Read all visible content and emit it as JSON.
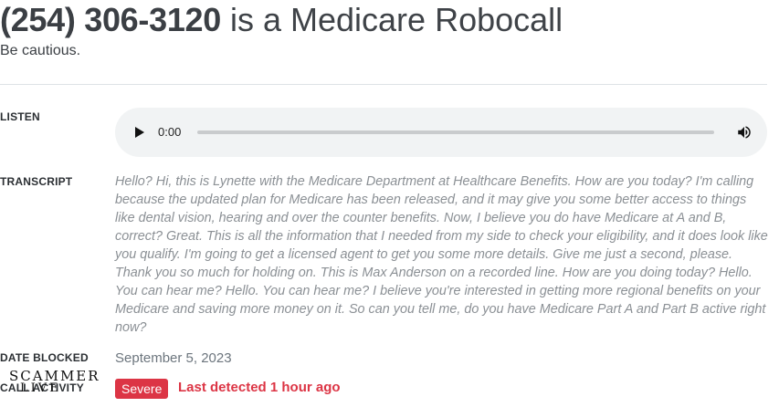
{
  "header": {
    "phone": "(254) 306-3120",
    "title_rest": " is a Medicare Robocall",
    "subtitle": "Be cautious."
  },
  "listen": {
    "label": "LISTEN",
    "player": {
      "time": "0:00",
      "progress": 0
    }
  },
  "transcript": {
    "label": "TRANSCRIPT",
    "text": "Hello? Hi, this is Lynette with the Medicare Department at Healthcare Benefits. How are you today? I'm calling because the updated plan for Medicare has been released, and it may give you some better access to things like dental vision, hearing and over the counter benefits. Now, I believe you do have Medicare at A and B, correct? Great. This is all the information that I needed from my side to check your eligibility, and it does look like you qualify. I'm going to get a licensed agent to get you some more details. Give me just a second, please. Thank you so much for holding on. This is Max Anderson on a recorded line. How are you doing today? Hello. You can hear me? Hello. You can hear me? I believe you're interested in getting more regional benefits on your Medicare and saving more money on it. So can you tell me, do you have Medicare Part A and Part B active right now?"
  },
  "date_blocked": {
    "label": "DATE BLOCKED",
    "value": "September 5, 2023"
  },
  "call_activity": {
    "label": "CALL ACTIVITY",
    "badge": "Severe",
    "detected": "Last detected 1 hour ago"
  },
  "logo": {
    "line1": "SCAMMER",
    "line2": "LIVE"
  },
  "colors": {
    "danger": "#dc3545",
    "player_bg": "#f1f3f4",
    "muted": "#8b9095"
  }
}
